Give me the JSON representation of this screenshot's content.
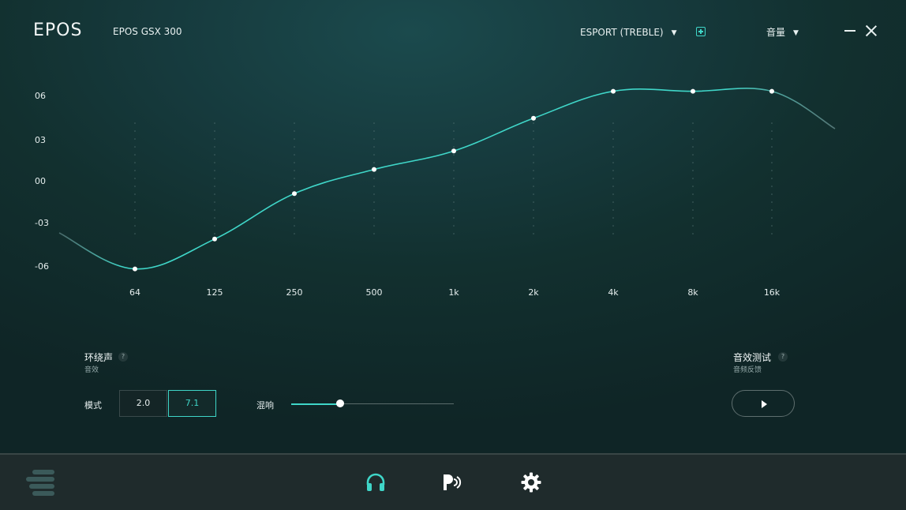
{
  "header": {
    "logo": "EPOS",
    "device_name": "EPOS GSX 300",
    "preset": "ESPORT (TREBLE)",
    "volume_label": "音量"
  },
  "eq": {
    "y_labels": [
      "06",
      "03",
      "00",
      "-03",
      "-06"
    ],
    "y_values": [
      6,
      3,
      0,
      -3,
      -6
    ],
    "bands": [
      "64",
      "125",
      "250",
      "500",
      "1k",
      "2k",
      "4k",
      "8k",
      "16k"
    ],
    "gains": [
      -6.2,
      -4.1,
      -0.9,
      0.8,
      2.1,
      4.4,
      6.3,
      6.3,
      6.3
    ]
  },
  "surround": {
    "title": "环绕声",
    "subtitle": "音效",
    "help": "?",
    "mode_label": "模式",
    "modes": [
      "2.0",
      "7.1"
    ],
    "selected_mode": "7.1",
    "reverb_label": "混响",
    "reverb_value": 0.3
  },
  "sound_test": {
    "title": "音效测试",
    "subtitle": "音频反馈",
    "help": "?"
  },
  "colors": {
    "accent": "#3fd6c8",
    "bottom_bar": "#1f2b2c"
  }
}
